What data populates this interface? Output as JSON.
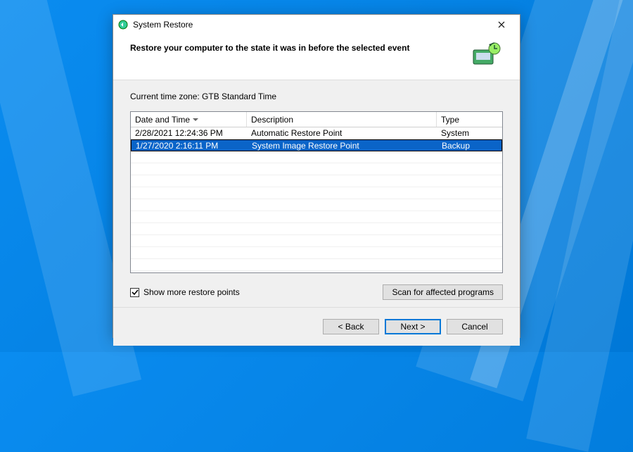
{
  "window": {
    "title": "System Restore"
  },
  "header": {
    "heading": "Restore your computer to the state it was in before the selected event"
  },
  "body": {
    "timezone_label": "Current time zone: GTB Standard Time",
    "columns": {
      "date": "Date and Time",
      "desc": "Description",
      "type": "Type"
    },
    "rows": [
      {
        "date": "2/28/2021 12:24:36 PM",
        "desc": "Automatic Restore Point",
        "type": "System",
        "selected": false
      },
      {
        "date": "1/27/2020 2:16:11 PM",
        "desc": "System Image Restore Point",
        "type": "Backup",
        "selected": true
      }
    ],
    "show_more_label": "Show more restore points",
    "show_more_checked": true,
    "scan_button": "Scan for affected programs"
  },
  "footer": {
    "back": "< Back",
    "next": "Next >",
    "cancel": "Cancel"
  }
}
